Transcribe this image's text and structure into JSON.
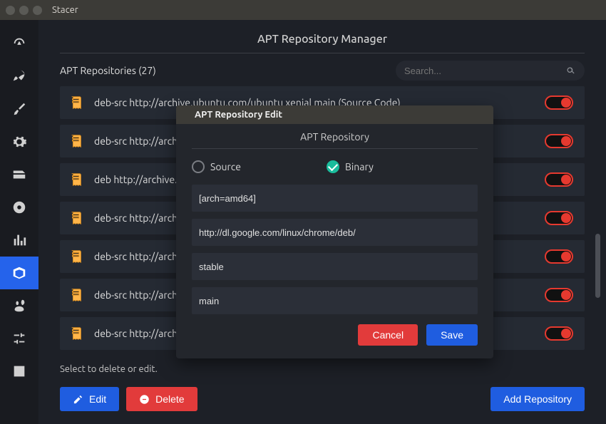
{
  "window": {
    "title": "Stacer"
  },
  "page": {
    "title": "APT Repository Manager",
    "list_label": "APT Repositories (27)",
    "search_placeholder": "Search...",
    "hint": "Select to delete or edit.",
    "edit_label": "Edit",
    "delete_label": "Delete",
    "add_label": "Add Repository"
  },
  "repos": [
    {
      "text": "deb-src http://archive.ubuntu.com/ubuntu xenial main (Source Code)",
      "enabled": true
    },
    {
      "text": "deb-src http://archive.ubuntu.com/ubuntu xenial-updates main (Source Code",
      "enabled": true
    },
    {
      "text": "deb http://archive.ubuntu.com/ubuntu xenial main",
      "enabled": true
    },
    {
      "text": "deb-src http://archive.ubuntu.com/ubuntu xenial universe (Source Code)",
      "enabled": true
    },
    {
      "text": "deb-src http://archive.ubuntu.com/ubuntu xenial-updates universe (Source Code)",
      "enabled": true
    },
    {
      "text": "deb-src http://archive.ubuntu.com/ubuntu xenial multiverse",
      "enabled": true
    },
    {
      "text": "deb-src http://archive.ubuntu.com/ubuntu xenial main (Source Code)",
      "enabled": true
    }
  ],
  "modal": {
    "title": "APT Repository Edit",
    "subtitle": "APT Repository",
    "source_label": "Source",
    "binary_label": "Binary",
    "selected": "binary",
    "arch": "[arch=amd64]",
    "url": "http://dl.google.com/linux/chrome/deb/",
    "dist": "stable",
    "component": "main",
    "cancel_label": "Cancel",
    "save_label": "Save"
  },
  "sidebar_icons": [
    "dashboard-icon",
    "rocket-icon",
    "brush-icon",
    "gear-icon",
    "tray-icon",
    "disk-icon",
    "chart-icon",
    "package-icon",
    "gnome-icon",
    "sliders-icon",
    "log-icon"
  ]
}
